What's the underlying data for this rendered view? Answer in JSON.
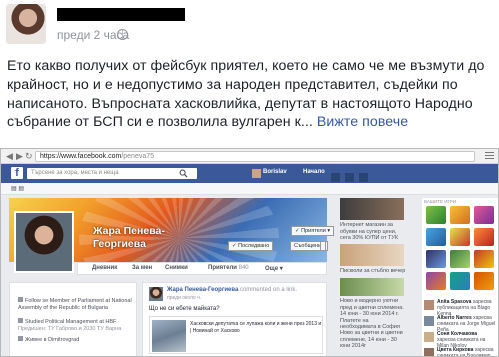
{
  "post": {
    "time": "преди 2 часа",
    "text_lines": [
      "Ето какво получих от фейсбук приятел, което не само че ме възмути до",
      "крайност, но и е недопустимо за народен представител, съдейки по",
      "написаното. Въпросната хасковлийка, депутат в настоящото Народно",
      "събрание от БСП си е позволила вулгарен к..."
    ],
    "see_more": "Вижте повече"
  },
  "screenshot": {
    "url_host": "https://www.facebook.com",
    "url_path": "/penevа75",
    "search_placeholder": "Търсене за хора, места и неща",
    "top_user": "Borislav",
    "top_home": "Начало",
    "profile_name_line1": "Жара Пенева-",
    "profile_name_line2": "Георгиева",
    "btn_friend": "✓ Приятели ▾",
    "btn_follow": "✓ Последвано",
    "btn_message": "Съобщение",
    "tabs": [
      "Дневник",
      "За мен",
      "Снимки",
      "Приятели",
      "Още ▾"
    ],
    "tab_counts": [
      "",
      "",
      "",
      "840",
      ""
    ],
    "left_items": [
      "Follow se Member of Parliament at National Assembly of the Republic of Bulgaria",
      "Studied Political Management at HBF",
      "Живее в Dimitrovgrad"
    ],
    "left_sub": "Предишен: ТУ Габрово и 2030 ТУ Варна",
    "post_author": "Жара Пенева-Георгиева",
    "post_author_rest": "commented on a link.",
    "post_time": "преди около ч.",
    "post_question": "Що не си ебете майката?",
    "link_text": "Хасковски депутатка се лупажа коли и жени през 2013 и | Новинай от Хасково",
    "ads": [
      "Интернет магазин за обувки на супер цени, сега 30% КУПИ от ТУК",
      "Пискюли за стъбло вечер",
      "Ново и модерно уютни пред и цветни сплемена. 14 юни - 30 юни 2014 г. Платете на необходимата в София",
      "Ново за цветни и цветни сплемене, 14 юни - 30 юни 2014г"
    ],
    "games_title": "ВАШИТЕ ИГРИ",
    "chats": [
      {
        "name": "Anita Spasova",
        "text": "харесва публикацията на Blago Kenna"
      },
      {
        "name": "Alberto Narres",
        "text": "харесва снимката на Jorge Miguel Peña"
      },
      {
        "name": "Соня Колчакова",
        "text": "харесва снимката на Milan Nikolov"
      },
      {
        "name": "Цвета Киркова",
        "text": "харесва снимката на Владимир Стефанов"
      }
    ]
  },
  "colors": {
    "fb_blue": "#3b5998",
    "link": "#365899",
    "muted": "#90949c"
  }
}
